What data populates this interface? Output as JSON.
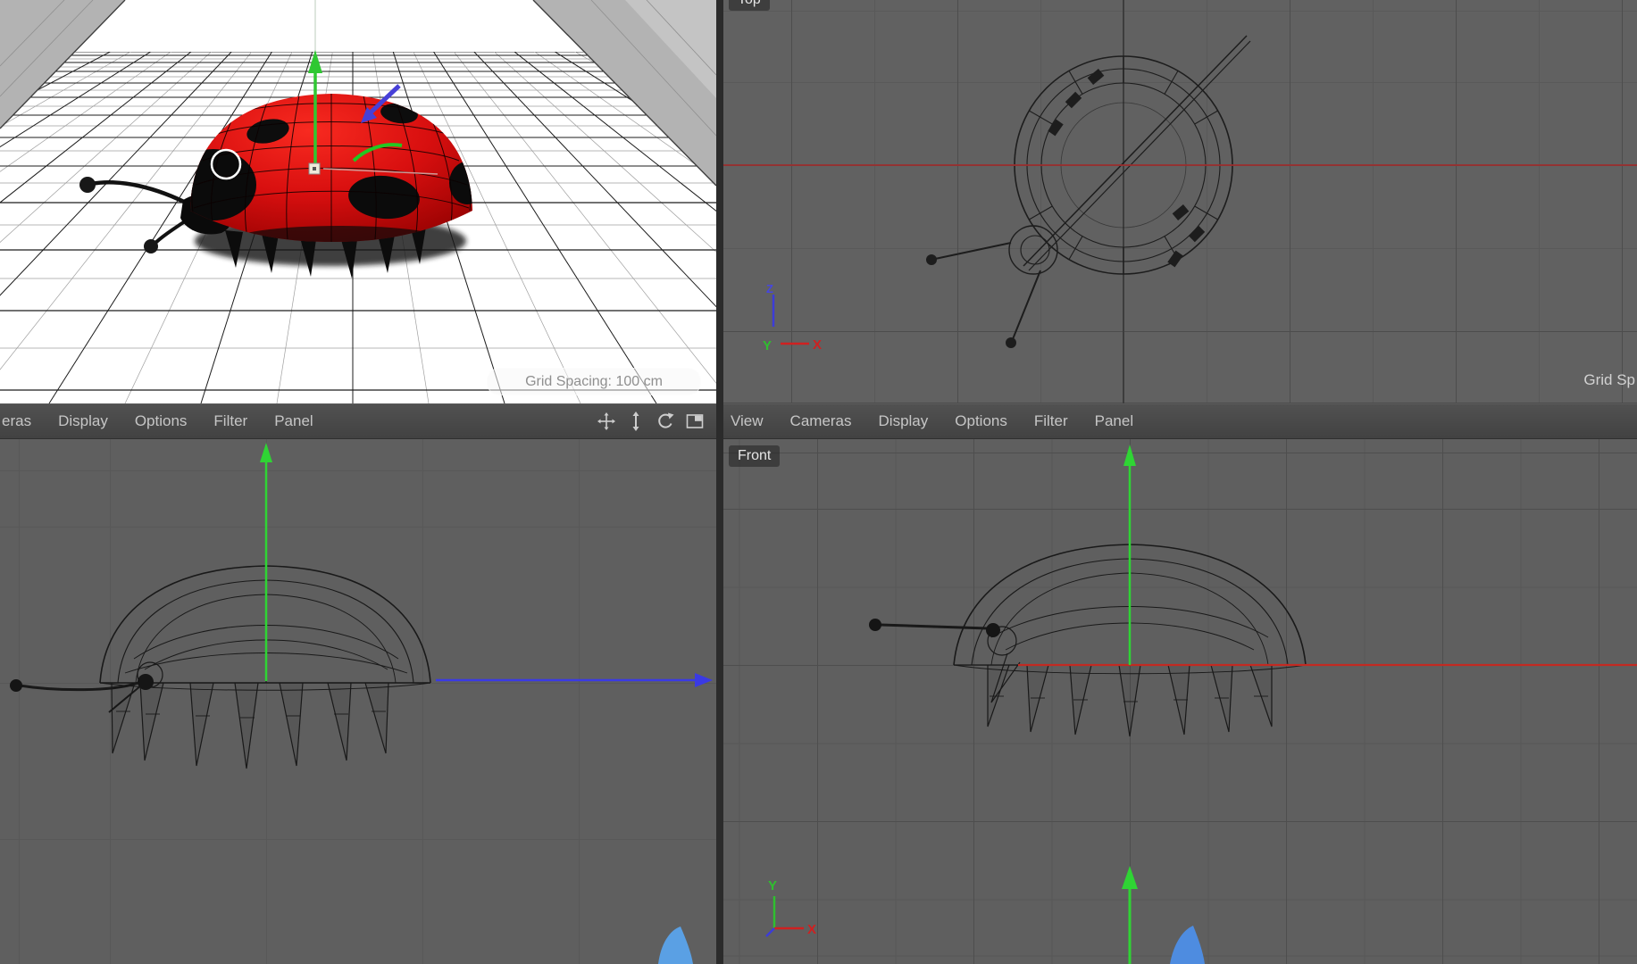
{
  "menubar_left": {
    "items": [
      "eras",
      "Display",
      "Options",
      "Filter",
      "Panel"
    ],
    "icons": [
      "pan-view-icon",
      "zoom-view-icon",
      "rotate-view-icon",
      "toggle-fullscreen-icon"
    ]
  },
  "menubar_right": {
    "items": [
      "View",
      "Cameras",
      "Display",
      "Options",
      "Filter",
      "Panel"
    ]
  },
  "viewports": {
    "perspective": {
      "hud_grid_spacing": "Grid Spacing: 100 cm"
    },
    "top": {
      "name_label": "Top",
      "hud_grid_spacing": "Grid Sp",
      "axis_labels": {
        "up": "Z",
        "out_of_screen": "Y",
        "right": "X"
      }
    },
    "front": {
      "name_label": "Front",
      "axis_labels": {
        "up": "Y",
        "right": "X"
      }
    }
  },
  "colors": {
    "axis_x_red": "#d02020",
    "axis_y_green": "#2fc832",
    "axis_z_blue": "#3c3cd8",
    "world_x_line_red": "#9c2e2e",
    "ladybug_red": "#d80f0f",
    "viewport_bg_dark": "#606060",
    "menubar_bg": "#464646"
  }
}
